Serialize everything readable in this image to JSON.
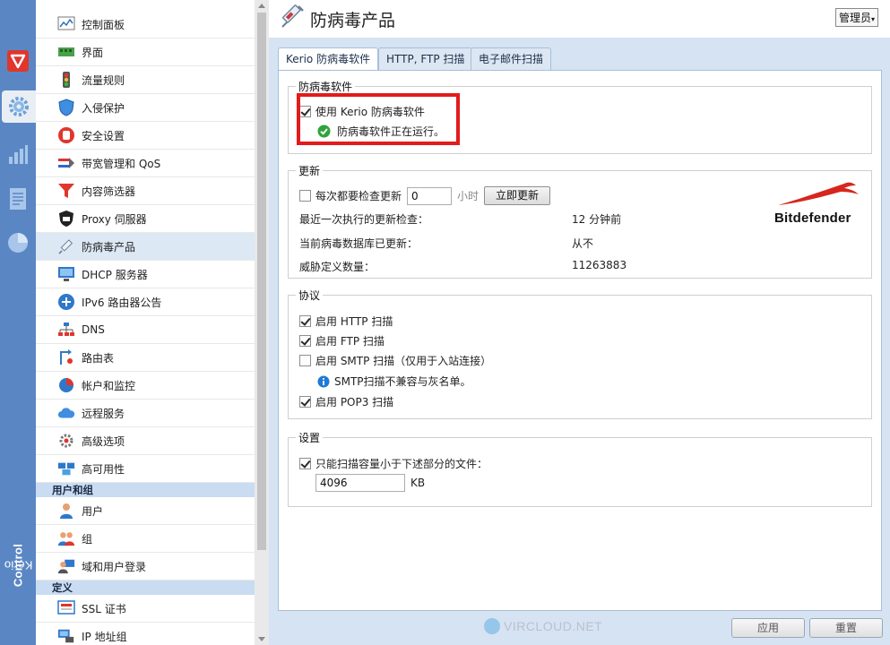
{
  "nav": {
    "items": [
      {
        "label": "控制面板",
        "icon": "dashboard-icon"
      },
      {
        "label": "界面",
        "icon": "interfaces-icon"
      },
      {
        "label": "流量规则",
        "icon": "traffic-light-icon"
      },
      {
        "label": "入侵保护",
        "icon": "shield-icon"
      },
      {
        "label": "安全设置",
        "icon": "hand-stop-icon"
      },
      {
        "label": "带宽管理和 QoS",
        "icon": "bandwidth-icon"
      },
      {
        "label": "内容筛选器",
        "icon": "filter-funnel-icon"
      },
      {
        "label": "Proxy 伺服器",
        "icon": "proxy-icon"
      },
      {
        "label": "防病毒产品",
        "icon": "syringe-icon"
      },
      {
        "label": "DHCP 服务器",
        "icon": "dhcp-monitor-icon"
      },
      {
        "label": "IPv6 路由器公告",
        "icon": "ipv6-router-icon"
      },
      {
        "label": "DNS",
        "icon": "dns-tree-icon"
      },
      {
        "label": "路由表",
        "icon": "routing-table-icon"
      },
      {
        "label": "帐户和监控",
        "icon": "accounting-chart-icon"
      },
      {
        "label": "远程服务",
        "icon": "cloud-icon"
      },
      {
        "label": "高级选项",
        "icon": "tools-gear-icon"
      },
      {
        "label": "高可用性",
        "icon": "high-availability-icon"
      }
    ],
    "section_users": "用户和组",
    "users_items": [
      {
        "label": "用户",
        "icon": "user-icon"
      },
      {
        "label": "组",
        "icon": "group-icon"
      },
      {
        "label": "域和用户登录",
        "icon": "domain-login-icon"
      }
    ],
    "section_defs": "定义",
    "defs_items": [
      {
        "label": "SSL 证书",
        "icon": "certificate-icon"
      },
      {
        "label": "IP 地址组",
        "icon": "ip-group-icon"
      }
    ]
  },
  "brand": {
    "prefix": "Kerio",
    "suffix": "Control"
  },
  "header": {
    "title": "防病毒产品",
    "admin": "管理员"
  },
  "tabs": [
    "Kerio 防病毒软件",
    "HTTP, FTP 扫描",
    "电子邮件扫描"
  ],
  "antivirus": {
    "group_title": "防病毒软件",
    "use_label": "使用 Kerio 防病毒软件",
    "status": "防病毒软件正在运行。"
  },
  "update": {
    "group_title": "更新",
    "check_label": "每次都要检查更新",
    "interval_value": "0",
    "unit": "小时",
    "update_now": "立即更新",
    "rows": [
      {
        "label": "最近一次执行的更新检查：",
        "value": "12 分钟前"
      },
      {
        "label": "当前病毒数据库已更新：",
        "value": "从不"
      },
      {
        "label": "威胁定义数量：",
        "value": "11263883"
      }
    ],
    "vendor": "Bitdefender"
  },
  "protocols": {
    "group_title": "协议",
    "http": "启用 HTTP 扫描",
    "ftp": "启用 FTP 扫描",
    "smtp": "启用 SMTP 扫描（仅用于入站连接）",
    "smtp_note": "SMTP扫描不兼容与灰名单。",
    "pop3": "启用 POP3 扫描"
  },
  "settings": {
    "group_title": "设置",
    "size_label": "只能扫描容量小于下述部分的文件：",
    "size_value": "4096",
    "size_unit": "KB"
  },
  "footer": {
    "apply": "应用",
    "reset": "重置"
  },
  "watermark": "VIRCLOUD.NET",
  "colors": {
    "rail": "#5a87c4",
    "content_bg": "#d5e3f3",
    "highlight": "#e21b1b",
    "ok_green": "#2fa43a",
    "info_blue": "#1f7ad6"
  }
}
